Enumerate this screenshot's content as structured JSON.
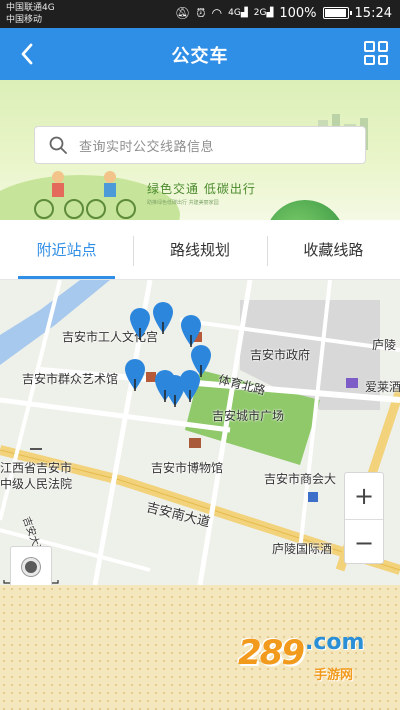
{
  "status_bar": {
    "carrier1": "中国联通4G",
    "carrier2": "中国移动",
    "signal1": "4G",
    "signal2": "2G",
    "battery_text": "100%",
    "battery_level": 1.0,
    "time": "15:24"
  },
  "app_bar": {
    "title": "公交车",
    "back_icon": "chevron-left-icon",
    "menu_icon": "grid-icon"
  },
  "banner": {
    "search_placeholder": "查询实时公交线路信息",
    "slogan": "绿色交通 低碳出行",
    "slogan_sub": "助推绿色低碳出行  共建美丽家园"
  },
  "tabs": [
    {
      "label": "附近站点",
      "active": true
    },
    {
      "label": "路线规划",
      "active": false
    },
    {
      "label": "收藏线路",
      "active": false
    }
  ],
  "map": {
    "labels": {
      "workers_palace": "吉安市工人文化宫",
      "gov": "吉安市政府",
      "luling": "庐陵",
      "mass_art": "吉安市群众艺术馆",
      "sports_rd": "体育北路",
      "aile": "爱莱酒",
      "city_square": "吉安城市广场",
      "court1": "江西省吉安市",
      "court2": "中级人民法院",
      "museum": "吉安市博物馆",
      "chamber": "吉安市商会大",
      "south_ave": "吉安南大道",
      "luling_hotel": "庐陵国际酒",
      "vertical_rd": "吉安大道"
    },
    "zoom_in": "+",
    "zoom_out": "−",
    "pin_color": "#2b86dc",
    "park_color": "#8fc96a"
  },
  "watermark": {
    "number": "289",
    "domain": ".com",
    "sub": "手游网"
  },
  "colors": {
    "primary": "#2f8ee6",
    "status_bg": "#1f1f1f"
  }
}
